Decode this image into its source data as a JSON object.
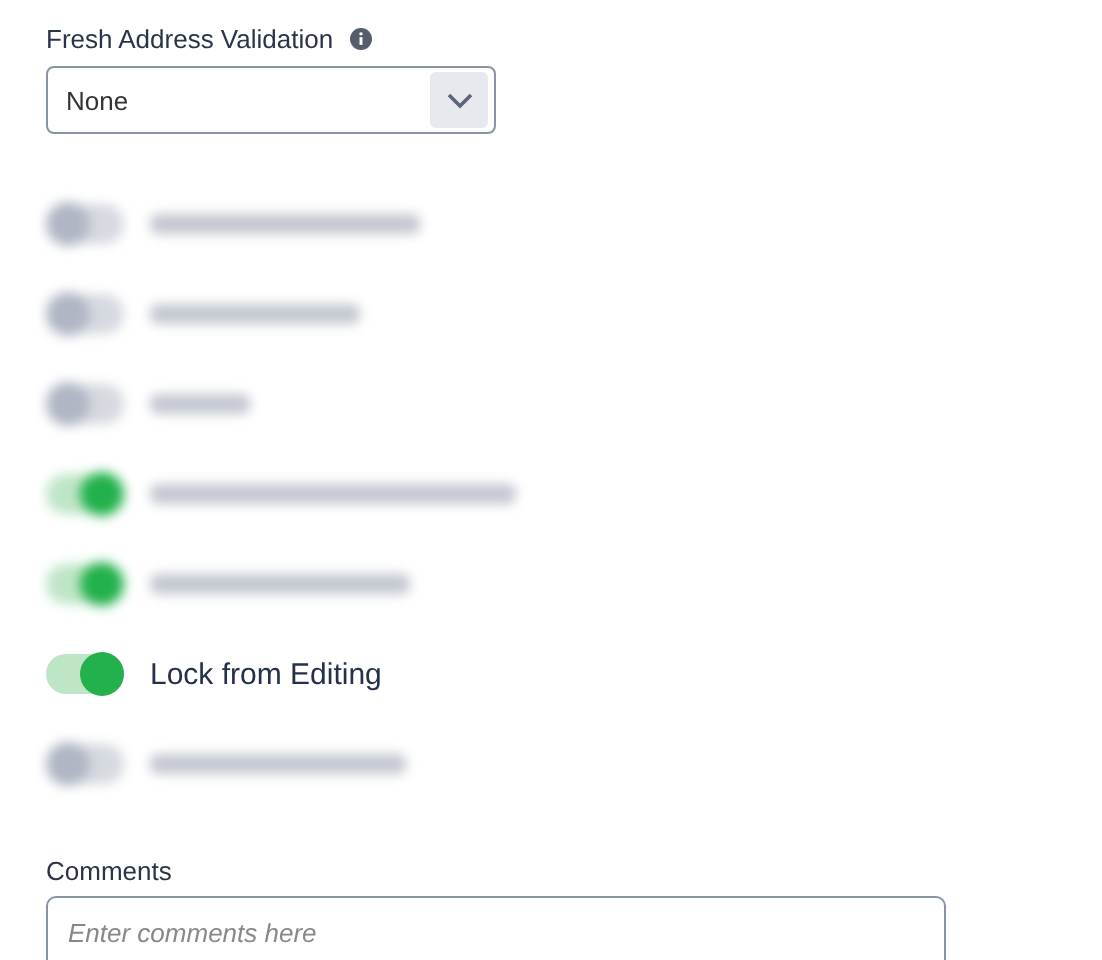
{
  "validation": {
    "label": "Fresh Address Validation",
    "value": "None"
  },
  "toggles": [
    {
      "on": false,
      "blurred": true
    },
    {
      "on": false,
      "blurred": true
    },
    {
      "on": false,
      "blurred": true
    },
    {
      "on": true,
      "blurred": true
    },
    {
      "on": true,
      "blurred": true
    },
    {
      "label": "Lock from Editing",
      "on": true,
      "blurred": false
    },
    {
      "on": false,
      "blurred": true
    }
  ],
  "comments": {
    "label": "Comments",
    "placeholder": "Enter comments here"
  }
}
